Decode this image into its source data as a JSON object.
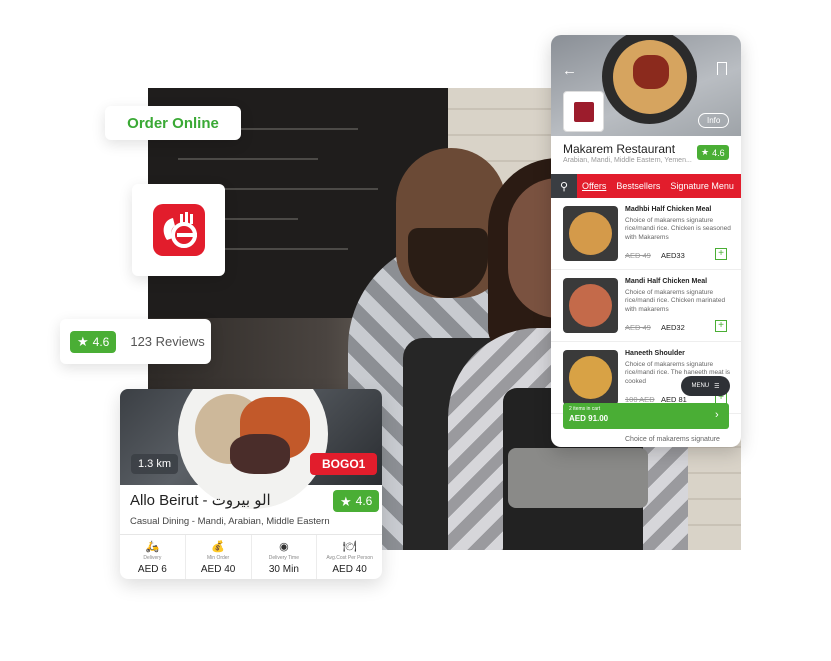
{
  "order_label": "Order Online",
  "rating_card": {
    "score": "4.6",
    "reviews": "123 Reviews"
  },
  "restaurant_card": {
    "distance": "1.3 km",
    "offer": "BOGO1",
    "name": "Allo Beirut - الو بيروت",
    "rating": "4.6",
    "category": "Casual Dining - Mandi, Arabian, Middle Eastern",
    "stats": [
      {
        "icon": "delivery-icon",
        "label": "Delivery",
        "value": "AED 6"
      },
      {
        "icon": "min-order-icon",
        "label": "Min Order",
        "value": "AED 40"
      },
      {
        "icon": "delivery-time-icon",
        "label": "Delivery Time",
        "value": "30 Min"
      },
      {
        "icon": "avg-cost-icon",
        "label": "Avg.Cost Per Person",
        "value": "AED 40"
      }
    ]
  },
  "phone": {
    "info_label": "Info",
    "restaurant_name": "Makarem Restaurant",
    "cuisines": "Arabian, Mandi, Middle Eastern, Yemen...",
    "rating": "4.6",
    "tabs": [
      "Offers",
      "Bestsellers",
      "Signature Menu"
    ],
    "items": [
      {
        "name": "Madhbi Half Chicken Meal",
        "desc": "Choice of makarems signature rice/mandi rice. Chicken is seasoned with Makarems",
        "old_price": "AED 49",
        "price": "AED33"
      },
      {
        "name": "Mandi Half Chicken Meal",
        "desc": "Choice of makarems signature rice/mandi rice. Chicken marinated with makarems",
        "old_price": "AED 49",
        "price": "AED32"
      },
      {
        "name": "Haneeth Shoulder",
        "desc": "Choice of makarems signature rice/mandi rice. The haneeth meat is cooked",
        "old_price": "100 AED",
        "price": "AED 81"
      }
    ],
    "menu_label": "MENU",
    "cart_items": "2 items in cart",
    "cart_total": "AED 91.00",
    "tail_text": "Choice of makarems signature"
  }
}
